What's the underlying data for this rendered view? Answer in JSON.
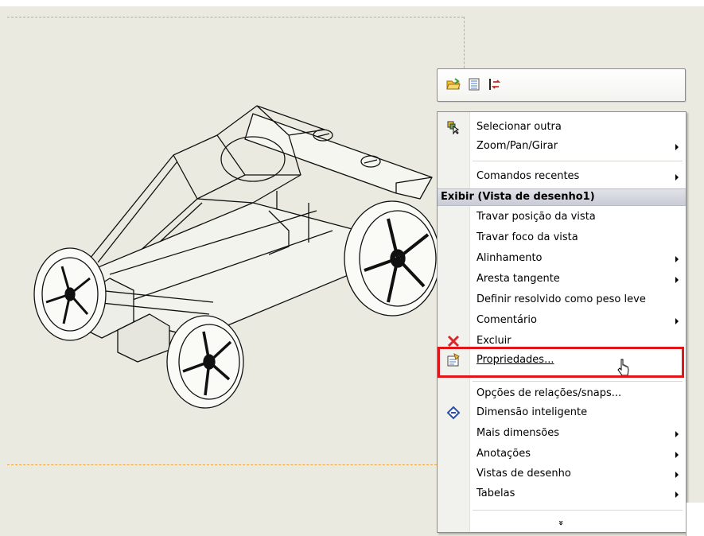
{
  "toolbar": {
    "icons": [
      "open-folder-icon",
      "grid-view-icon",
      "swap-icon"
    ]
  },
  "menu": {
    "items_top": [
      {
        "label": "Selecionar outra",
        "icon": "select-other-icon",
        "submenu": false
      },
      {
        "label": "Zoom/Pan/Girar",
        "submenu": true
      },
      {
        "label": "Comandos recentes",
        "submenu": true
      }
    ],
    "section_header": "Exibir (Vista de desenho1)",
    "items_section": [
      {
        "label": "Travar posição da vista",
        "submenu": false
      },
      {
        "label": "Travar foco da vista",
        "submenu": false
      },
      {
        "label": "Alinhamento",
        "submenu": true
      },
      {
        "label": "Aresta tangente",
        "submenu": true
      },
      {
        "label": "Definir resolvido como peso leve",
        "submenu": false
      },
      {
        "label": "Comentário",
        "submenu": true
      },
      {
        "label": "Excluir",
        "icon": "delete-x-icon",
        "submenu": false
      },
      {
        "label": "Propriedades...",
        "icon": "properties-icon",
        "submenu": false
      }
    ],
    "items_bottom": [
      {
        "label": "Opções de relações/snaps...",
        "submenu": false
      },
      {
        "label": "Dimensão inteligente",
        "icon": "smart-dimension-icon",
        "submenu": false
      },
      {
        "label": "Mais dimensões",
        "submenu": true
      },
      {
        "label": "Anotações",
        "submenu": true
      },
      {
        "label": "Vistas de desenho",
        "submenu": true
      },
      {
        "label": "Tabelas",
        "submenu": true
      }
    ],
    "expand_glyph": "»"
  },
  "colors": {
    "highlight": "#e0161b",
    "sheet_border": "#f2a33c",
    "background": "#ebeae0"
  }
}
